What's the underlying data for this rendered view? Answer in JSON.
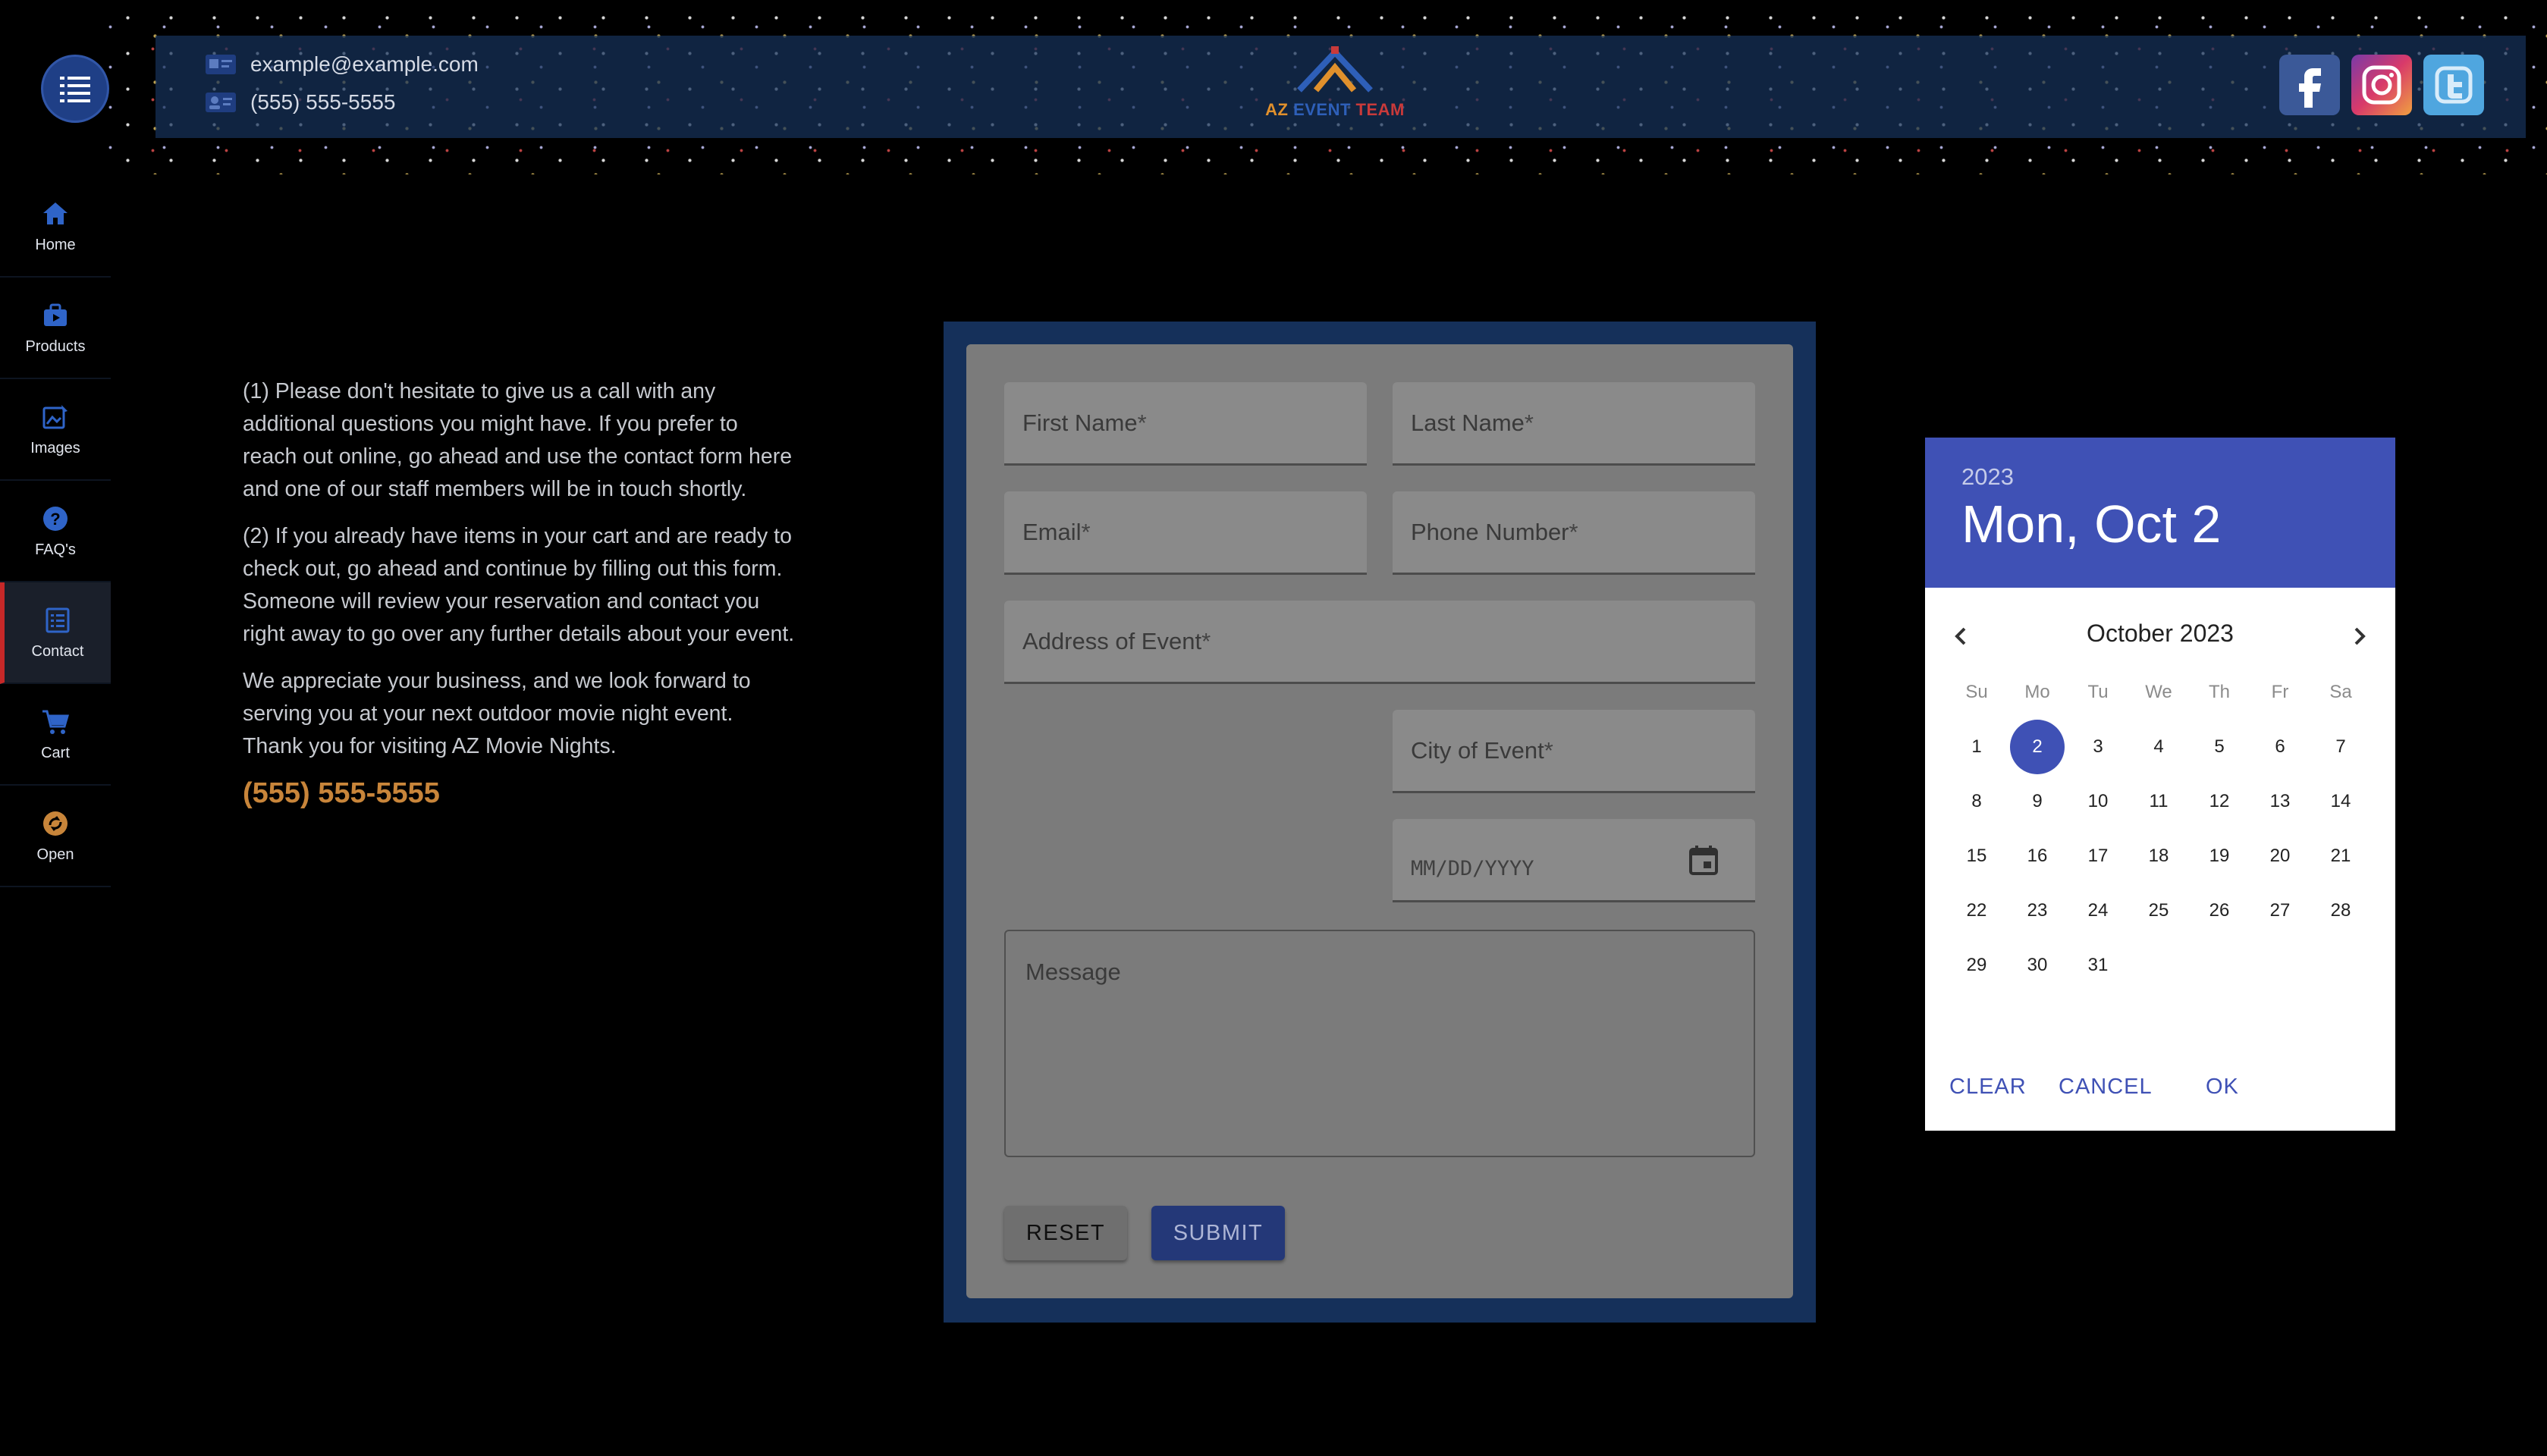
{
  "header": {
    "email": "example@example.com",
    "phone": "(555) 555-5555",
    "logo": {
      "az": "AZ",
      "event": "EVENT",
      "team": "TEAM"
    },
    "social": [
      "facebook-icon",
      "instagram-icon",
      "twitter-icon"
    ]
  },
  "sidebar": {
    "items": [
      {
        "label": "Home",
        "icon": "home-icon"
      },
      {
        "label": "Products",
        "icon": "products-icon"
      },
      {
        "label": "Images",
        "icon": "images-icon"
      },
      {
        "label": "FAQ's",
        "icon": "faq-icon"
      },
      {
        "label": "Contact",
        "icon": "contact-icon",
        "active": true
      },
      {
        "label": "Cart",
        "icon": "cart-icon"
      },
      {
        "label": "Open",
        "icon": "open-icon"
      }
    ]
  },
  "intro": {
    "p1": "(1) Please don't hesitate to give us a call with any additional questions you might have. If you prefer to reach out online, go ahead and use the contact form here and one of our staff members will be in touch shortly.",
    "p2": "(2) If you already have items in your cart and are ready to check out, go ahead and continue by filling out this form. Someone will review your reservation and contact you right away to go over any further details about your event.",
    "p3": "We appreciate your business, and we look forward to serving you at your next outdoor movie night event. Thank you for visiting AZ Movie Nights.",
    "phone": "(555) 555-5555"
  },
  "form": {
    "first_name": "First Name",
    "last_name": "Last Name",
    "email": "Email",
    "phone": "Phone Number",
    "address": "Address of Event",
    "city": "City of Event",
    "date_placeholder": "MM/DD/YYYY",
    "message": "Message",
    "required_mark": "*",
    "reset": "RESET",
    "submit": "SUBMIT"
  },
  "datepicker": {
    "year": "2023",
    "selected_label": "Mon, Oct 2",
    "month_label": "October 2023",
    "weekdays": [
      "Su",
      "Mo",
      "Tu",
      "We",
      "Th",
      "Fr",
      "Sa"
    ],
    "first_weekday_index": 0,
    "days_in_month": 31,
    "selected_day": 2,
    "clear": "CLEAR",
    "cancel": "CANCEL",
    "ok": "OK",
    "accent": "#3f51b5"
  }
}
